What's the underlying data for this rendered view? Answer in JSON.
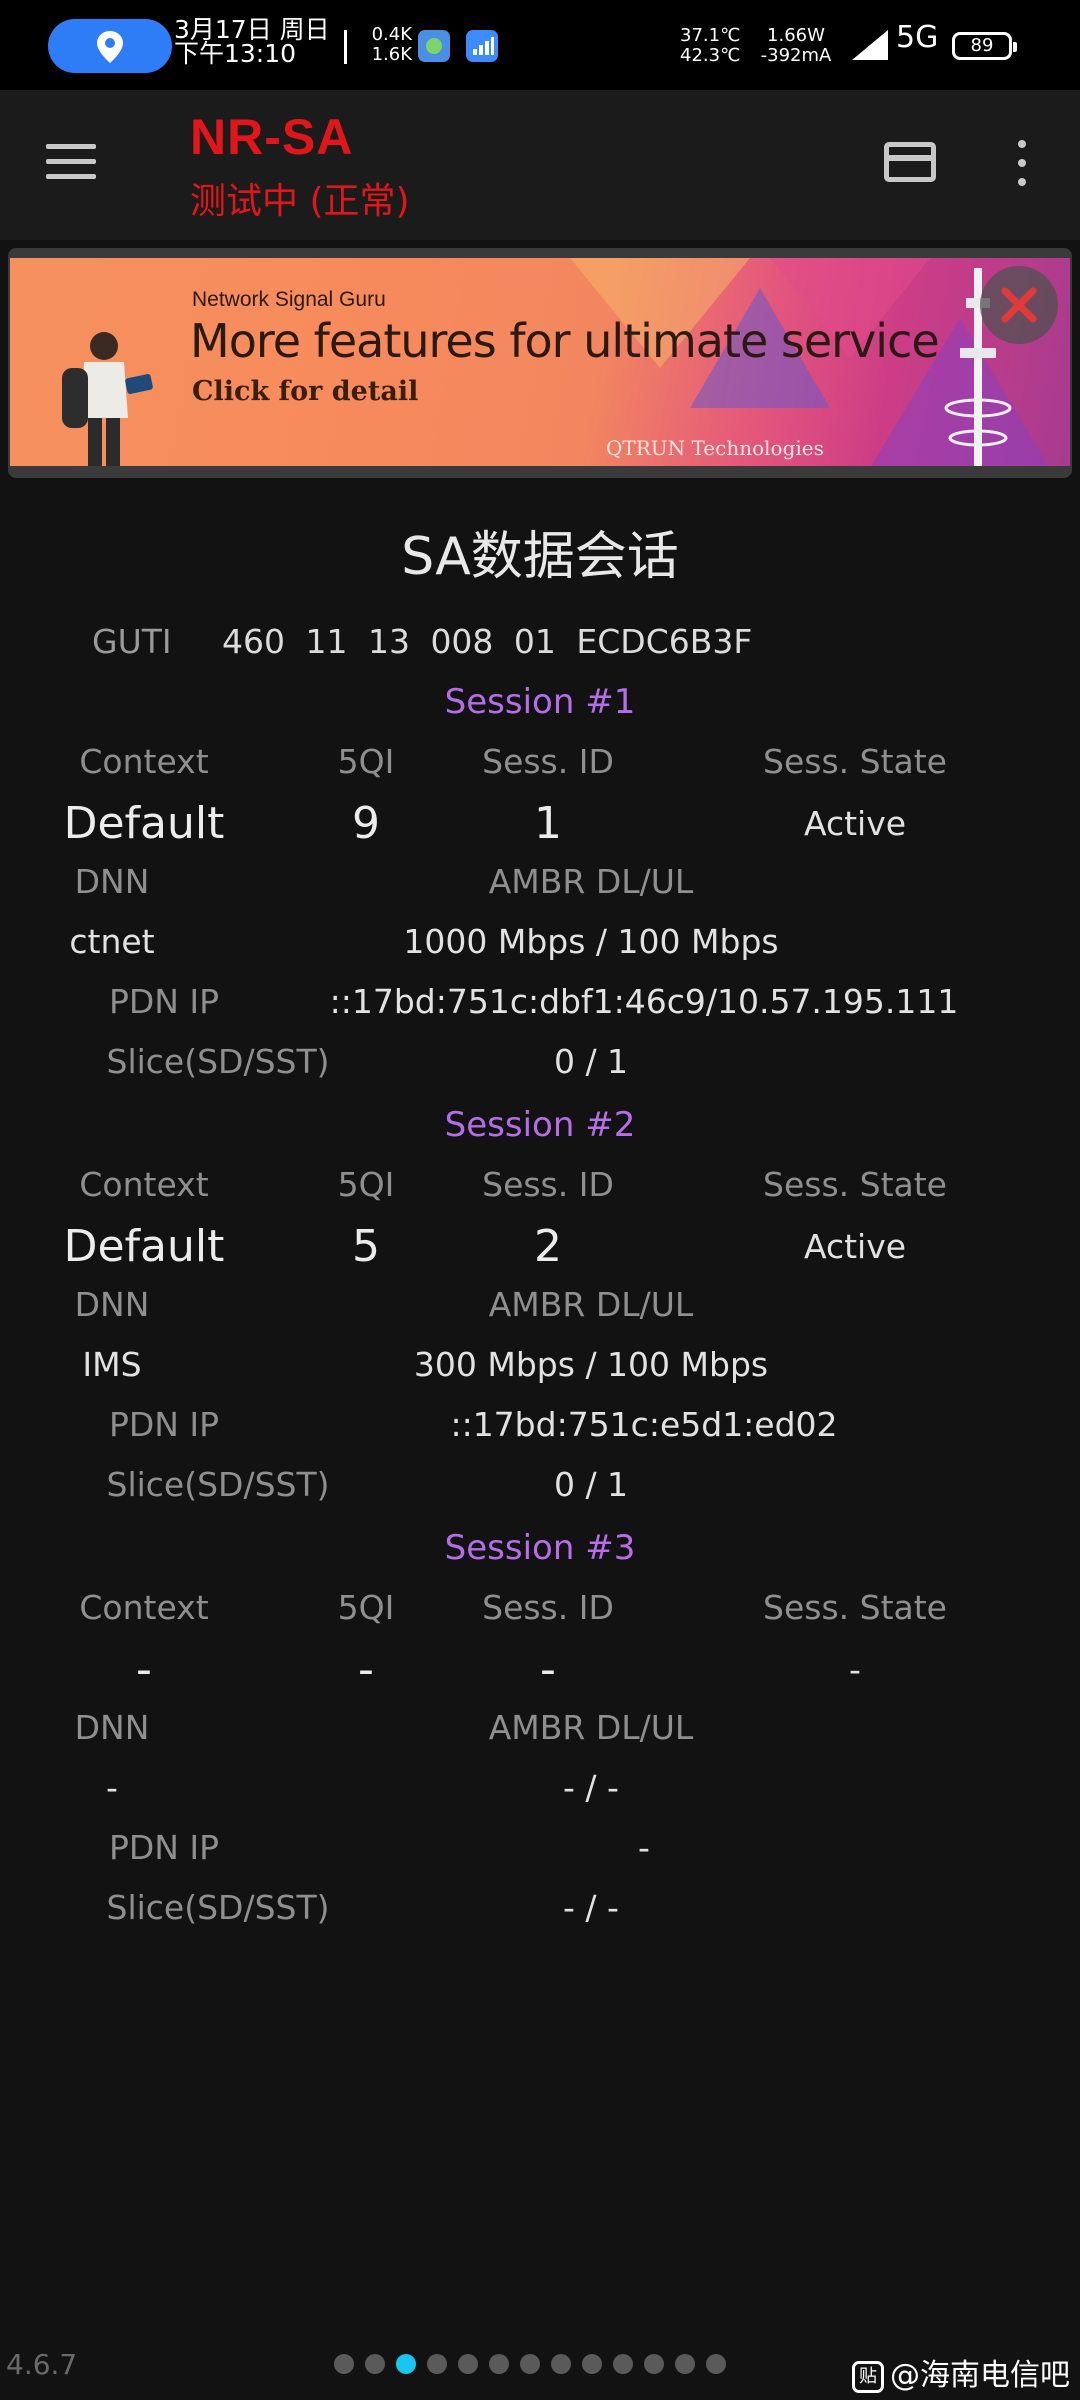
{
  "status_bar": {
    "date": "3月17日 周日",
    "time": "下午13:10",
    "speed_up": "0.4K",
    "speed_down": "1.6K",
    "temp_1": "37.1℃",
    "temp_2": "42.3℃",
    "power": "1.66W",
    "current": "-392mA",
    "network": "5G",
    "battery": "89"
  },
  "app_bar": {
    "title": "NR-SA",
    "subtitle": "测试中 (正常)"
  },
  "banner": {
    "small_text": "Network Signal Guru",
    "headline": "More features for ultimate service",
    "cta": "Click for detail",
    "brand": "QTRUN Technologies"
  },
  "page_title": "SA数据会话",
  "guti": {
    "label": "GUTI",
    "value": "460  11  13  008  01  ECDC6B3F"
  },
  "labels": {
    "context": "Context",
    "fiveqi": "5QI",
    "sess_id": "Sess. ID",
    "sess_state": "Sess. State",
    "dnn": "DNN",
    "ambr": "AMBR DL/UL",
    "pdn_ip": "PDN IP",
    "slice": "Slice(SD/SST)"
  },
  "sessions": [
    {
      "title": "Session #1",
      "context": "Default",
      "fiveqi": "9",
      "sess_id": "1",
      "state": "Active",
      "dnn": "ctnet",
      "ambr": "1000 Mbps / 100 Mbps",
      "pdn_ip": "::17bd:751c:dbf1:46c9/10.57.195.111",
      "slice": "0 / 1"
    },
    {
      "title": "Session #2",
      "context": "Default",
      "fiveqi": "5",
      "sess_id": "2",
      "state": "Active",
      "dnn": "IMS",
      "ambr": "300 Mbps / 100 Mbps",
      "pdn_ip": "::17bd:751c:e5d1:ed02",
      "slice": "0 / 1"
    },
    {
      "title": "Session #3",
      "context": "-",
      "fiveqi": "-",
      "sess_id": "-",
      "state": "-",
      "dnn": "-",
      "ambr": "- / -",
      "pdn_ip": "-",
      "slice": "- / -"
    }
  ],
  "footer": {
    "version": "4.6.7",
    "page_count": 13,
    "active_page": 3,
    "watermark": "@海南电信吧",
    "watermark_badge": "贴"
  },
  "colors": {
    "accent_red": "#e0161b",
    "session_purple": "#b66de8",
    "page_dot_active": "#19c6f0"
  }
}
